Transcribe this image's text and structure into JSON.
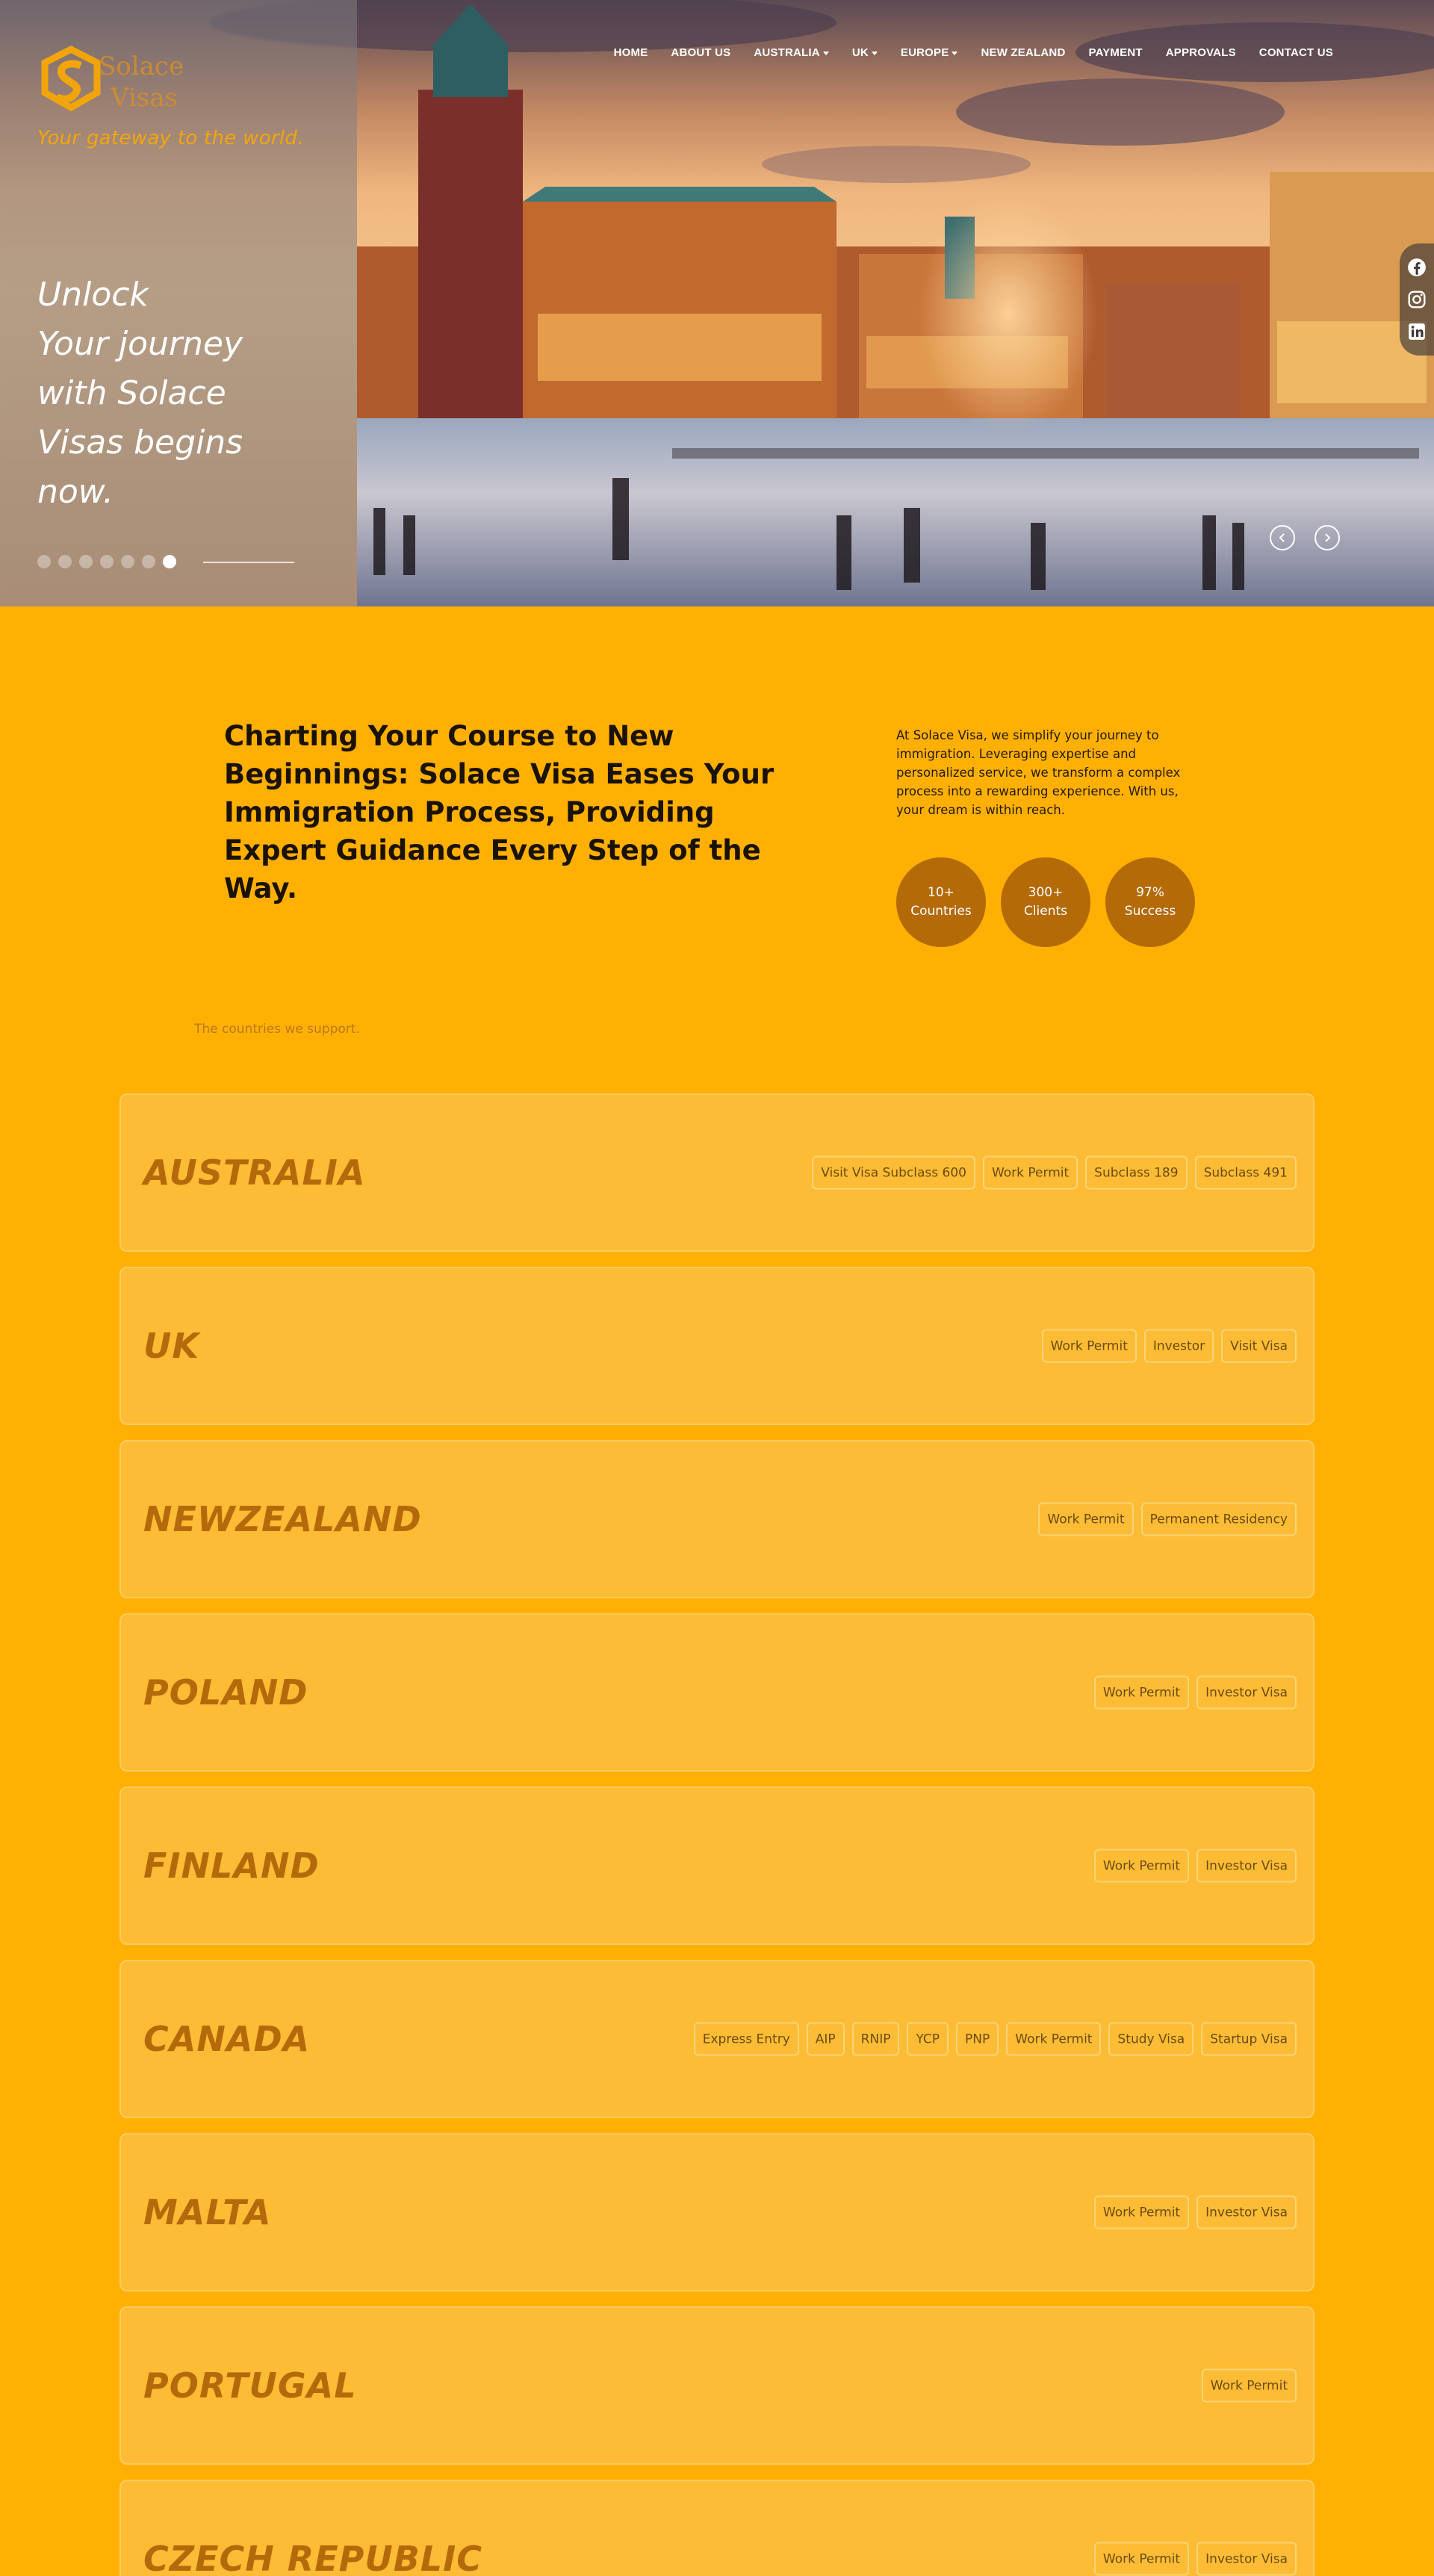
{
  "brand": {
    "logo_text_1": "Solace",
    "logo_text_2": "Visas",
    "tagline": "Your gateway to the world.",
    "accent": "#ffb003",
    "dark_accent": "#b46a06"
  },
  "nav": {
    "items": [
      {
        "label": "HOME",
        "dropdown": false
      },
      {
        "label": "ABOUT US",
        "dropdown": false
      },
      {
        "label": "AUSTRALIA",
        "dropdown": true
      },
      {
        "label": "UK",
        "dropdown": true
      },
      {
        "label": "EUROPE",
        "dropdown": true
      },
      {
        "label": "NEW ZEALAND",
        "dropdown": false
      },
      {
        "label": "PAYMENT",
        "dropdown": false
      },
      {
        "label": "APPROVALS",
        "dropdown": false
      },
      {
        "label": "CONTACT US",
        "dropdown": false
      }
    ]
  },
  "hero": {
    "heading_lines": [
      "Unlock",
      "Your journey",
      "with Solace",
      "Visas begins",
      "now."
    ],
    "slide_count": 7,
    "active_slide": 7,
    "social_icons": [
      "facebook-icon",
      "instagram-icon",
      "linkedin-icon"
    ],
    "prev_icon": "chevron-left-icon",
    "next_icon": "chevron-right-icon"
  },
  "intro": {
    "title": "Charting Your Course to New Beginnings: Solace Visa Eases Your Immigration Process, Providing Expert Guidance Every Step of the Way.",
    "text": "At Solace Visa, we simplify your journey to immigration. Leveraging expertise and personalized service, we transform a complex process into a rewarding experience. With us, your dream is within reach.",
    "stats": [
      {
        "value": "10+",
        "label": "Countries"
      },
      {
        "value": "300+",
        "label": "Clients"
      },
      {
        "value": "97%",
        "label": "Success"
      }
    ]
  },
  "countries": {
    "label": "The countries we support.",
    "list": [
      {
        "name": "AUSTRALIA",
        "visas": [
          "Visit Visa Subclass 600",
          "Work Permit",
          "Subclass 189",
          "Subclass 491"
        ]
      },
      {
        "name": "UK",
        "visas": [
          "Work Permit",
          "Investor",
          "Visit Visa"
        ]
      },
      {
        "name": "NEWZEALAND",
        "visas": [
          "Work Permit",
          "Permanent Residency"
        ]
      },
      {
        "name": "POLAND",
        "visas": [
          "Work Permit",
          "Investor Visa"
        ]
      },
      {
        "name": "FINLAND",
        "visas": [
          "Work Permit",
          "Investor Visa"
        ]
      },
      {
        "name": "CANADA",
        "visas": [
          "Express Entry",
          "AIP",
          "RNIP",
          "YCP",
          "PNP",
          "Work Permit",
          "Study Visa",
          "Startup Visa"
        ]
      },
      {
        "name": "MALTA",
        "visas": [
          "Work Permit",
          "Investor Visa"
        ]
      },
      {
        "name": "PORTUGAL",
        "visas": [
          "Work Permit"
        ]
      },
      {
        "name": "CZECH REPUBLIC",
        "visas": [
          "Work Permit",
          "Investor Visa"
        ]
      }
    ]
  }
}
